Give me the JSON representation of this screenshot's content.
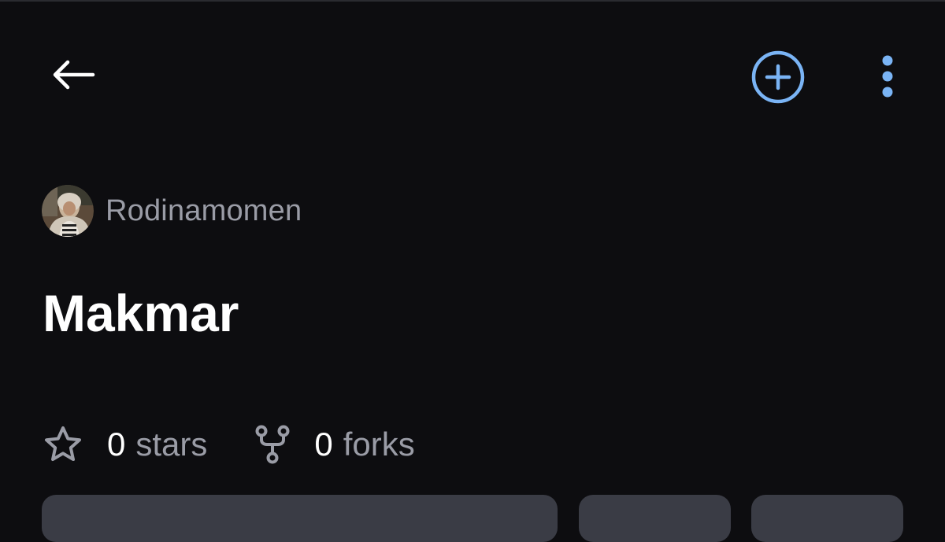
{
  "header": {
    "back_icon": "arrow-left-icon",
    "add_icon": "plus-circle-icon",
    "more_icon": "kebab-menu-icon",
    "accent_color": "#7ab4f5",
    "icon_color": "#ffffff"
  },
  "repo": {
    "owner": "Rodinamomen",
    "name": "Makmar"
  },
  "stats": {
    "stars_count": "0",
    "stars_label": "stars",
    "forks_count": "0",
    "forks_label": "forks",
    "star_icon": "star-icon",
    "fork_icon": "fork-icon"
  },
  "colors": {
    "background": "#0d0d10",
    "muted_text": "#9a9ca6",
    "card": "#3a3c45"
  }
}
